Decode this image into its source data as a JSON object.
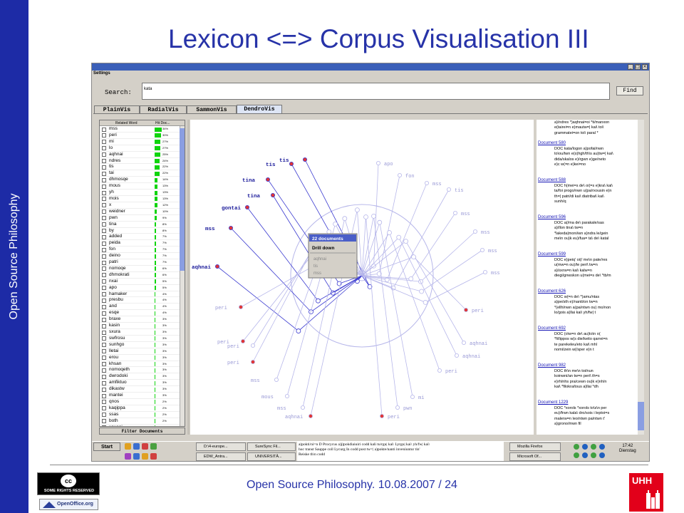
{
  "slide": {
    "sidebar_text": "Open Source Philosophy",
    "title": "Lexicon <=> Corpus Visualisation III",
    "footer": "Open Source Philosophy. 10.08.2007 / 24",
    "cc_badge_text": "SOME RIGHTS RESERVED",
    "cc_badge_symbol": "cc",
    "oo_badge_text": "OpenOffice.org",
    "uhh_logo_text": "UHH"
  },
  "app": {
    "menu": "Settings",
    "search": {
      "label": "Search:",
      "value": "kata",
      "find_label": "Find"
    },
    "tabs": [
      "PlainVis",
      "RadialVis",
      "SammonVis",
      "DendroVis"
    ],
    "active_tab": "DendroVis",
    "word_list": {
      "headers": [
        "Related Word",
        "Hit Doc..."
      ],
      "rows": [
        {
          "word": "mss",
          "pct": "34%",
          "bar": 0.34
        },
        {
          "word": "peri",
          "pct": "30%",
          "bar": 0.3
        },
        {
          "word": "mi",
          "pct": "27%",
          "bar": 0.27
        },
        {
          "word": "lo",
          "pct": "27%",
          "bar": 0.27
        },
        {
          "word": "aqhnai",
          "pct": "25%",
          "bar": 0.25
        },
        {
          "word": "ndres",
          "pct": "24%",
          "bar": 0.24
        },
        {
          "word": "tis",
          "pct": "22%",
          "bar": 0.22
        },
        {
          "word": "tai",
          "pct": "22%",
          "bar": 0.22
        },
        {
          "word": "dhmosqe",
          "pct": "14%",
          "bar": 0.14
        },
        {
          "word": "mous",
          "pct": "13%",
          "bar": 0.13
        },
        {
          "word": "yh",
          "pct": "13%",
          "bar": 0.13
        },
        {
          "word": "mois",
          "pct": "13%",
          "bar": 0.13
        },
        {
          "word": "x",
          "pct": "12%",
          "bar": 0.12
        },
        {
          "word": "weidner",
          "pct": "10%",
          "bar": 0.1
        },
        {
          "word": "pwn",
          "pct": "9%",
          "bar": 0.09
        },
        {
          "word": "tina",
          "pct": "8%",
          "bar": 0.08
        },
        {
          "word": "by",
          "pct": "8%",
          "bar": 0.08
        },
        {
          "word": "added",
          "pct": "7%",
          "bar": 0.07
        },
        {
          "word": "peida",
          "pct": "7%",
          "bar": 0.07
        },
        {
          "word": "fon",
          "pct": "7%",
          "bar": 0.07
        },
        {
          "word": "deino",
          "pct": "7%",
          "bar": 0.07
        },
        {
          "word": "patri",
          "pct": "7%",
          "bar": 0.07
        },
        {
          "word": "nomoqe",
          "pct": "6%",
          "bar": 0.06
        },
        {
          "word": "dhmokrati",
          "pct": "6%",
          "bar": 0.06
        },
        {
          "word": "nxai",
          "pct": "5%",
          "bar": 0.05
        },
        {
          "word": "apo",
          "pct": "5%",
          "bar": 0.05
        },
        {
          "word": "hamaker",
          "pct": "4%",
          "bar": 0.04
        },
        {
          "word": "presbu",
          "pct": "4%",
          "bar": 0.04
        },
        {
          "word": "and",
          "pct": "4%",
          "bar": 0.04
        },
        {
          "word": "esqe",
          "pct": "4%",
          "bar": 0.04
        },
        {
          "word": "braxe",
          "pct": "3%",
          "bar": 0.03
        },
        {
          "word": "kasin",
          "pct": "3%",
          "bar": 0.03
        },
        {
          "word": "sxura",
          "pct": "3%",
          "bar": 0.03
        },
        {
          "word": "swfrosu",
          "pct": "3%",
          "bar": 0.03
        },
        {
          "word": "sunhgo",
          "pct": "3%",
          "bar": 0.03
        },
        {
          "word": "lletai",
          "pct": "3%",
          "bar": 0.03
        },
        {
          "word": "erou",
          "pct": "3%",
          "bar": 0.03
        },
        {
          "word": "khsan",
          "pct": "3%",
          "bar": 0.03
        },
        {
          "word": "nomoqeth",
          "pct": "3%",
          "bar": 0.03
        },
        {
          "word": "dwrodoki",
          "pct": "3%",
          "bar": 0.03
        },
        {
          "word": "amfiktuo",
          "pct": "3%",
          "bar": 0.03
        },
        {
          "word": "dikastw",
          "pct": "3%",
          "bar": 0.03
        },
        {
          "word": "mantei",
          "pct": "3%",
          "bar": 0.03
        },
        {
          "word": "qnos",
          "pct": "2%",
          "bar": 0.02
        },
        {
          "word": "kaqippa",
          "pct": "2%",
          "bar": 0.02
        },
        {
          "word": "ssas",
          "pct": "2%",
          "bar": 0.02
        },
        {
          "word": "both",
          "pct": "2%",
          "bar": 0.02
        },
        {
          "word": "xousai",
          "pct": "2%",
          "bar": 0.02
        }
      ],
      "filter_label": "Filter Documents"
    },
    "dendro_labels": [
      "tis",
      "tis",
      "tina",
      "tina",
      "gontai",
      "mss",
      "aqhnai",
      "apo",
      "fon",
      "mss",
      "tis",
      "mss",
      "mss",
      "mss",
      "mss",
      "peri",
      "peri",
      "peri",
      "peri",
      "mss",
      "mous",
      "mss",
      "aqhnai",
      "peri",
      "pwn",
      "mi",
      "peri",
      "aqhnai",
      "aqhnai",
      "peri"
    ],
    "context_menu": {
      "title": "22 documents",
      "action": "Drill down",
      "items": [
        "aqhnai",
        "tis",
        "mss"
      ]
    },
    "doc_intro": "a)/ndres *)aqhnai=oi *ti/manxon\ne(tairei=n e)mautw=| kai\\ toi\\\ngrammatei=on toi\\ paral *",
    "documents": [
      {
        "title": "Document 580",
        "text": "DOC kata/logon a)pofai/nwn\nto\\ou/twn e(s)hgh/th\\s au)tw=| kai\\\ndida/skalos e)/rgwn e)ge/neto\ne)c w(=n e)kei=no"
      },
      {
        "title": "Document 588",
        "text": "DOC h(mei=s de\\ oi(=s e)kra\\ kai\\\nta/foi progo/nwn u(pa/rxousin e)n\nth=| patri/di kai\\ diatribai\\ kai\\\nsunh/q"
      },
      {
        "title": "Document 596",
        "text": "DOC a(/ma de\\ parakale/sas\na)/llon tina\\ tw=n\n*lakeda|moni/wn a)ndra le/gein\nme\\n ou)k eu)/fua= ta\\ de\\ katal"
      },
      {
        "title": "Document 599",
        "text": "DOC e)peiq' oi(/ me\\n pate/res\nu(mw=n ou)/te peri\\ tw=n\na)/sxrw=n kai\\ kalw=n\ndiegi/gnwskon u(mei=s de\\ *tb/m"
      },
      {
        "title": "Document 626",
        "text": "DOC w(=n de\\ *)amu/ntas\na)pe/sth e)/nanti/on tw=n\n*(ellh/nwn a(pa/ntwn ou) mo/non\nlo/gois a)llai kai\\ yh/fw| t"
      },
      {
        "title": "Document 692",
        "text": "DOC (o\\w=n de\\ au)to\\n o(\n*fi/lippos w(s die/keito qarrei=n\nte parekeleu/eto kai\\ mhl\nnomi/zein w(/sper e)n t"
      },
      {
        "title": "Document 982",
        "text": "DOC th\\n me\\n toi/nun\nkoinwni/an tw=n peri\\ th=s\ne)rh/nhs pra/cewn ou)k e)nh/n\nkai\\ *filokra/tous a)llai *dh"
      },
      {
        "title": "Document 1229",
        "text": "DOC *xorols *xorols to\\s\\n per\neu)/frwn kala\\ dro/sois i leptoi=s\nmalerw=n leo/ntwn pa/ntwn t'\na)grono/mwn fil"
      }
    ],
    "taskbar": {
      "start": "Start",
      "buttons": [
        "D:\\4-europe...",
        "SureSync Fil...",
        "EDW_Antra...",
        "UNIVERSITÄ...",
        "Mozilla Firefox",
        "Microsoft Of..."
      ],
      "clock_time": "17:42",
      "clock_day": "Dienstag",
      "mid_text": "a)pokti/ni=n D Procycus a)j)pokdiaiuiri codd kali tu/rgu| kai\\ Lyrgu| kai\\ yh/fw| kai\\\nhuc transt Sauppe coll Lycurg In codd post tw=| a)pokte/nanti inveniuntur tin'\nReiske th\\n codd"
    }
  }
}
